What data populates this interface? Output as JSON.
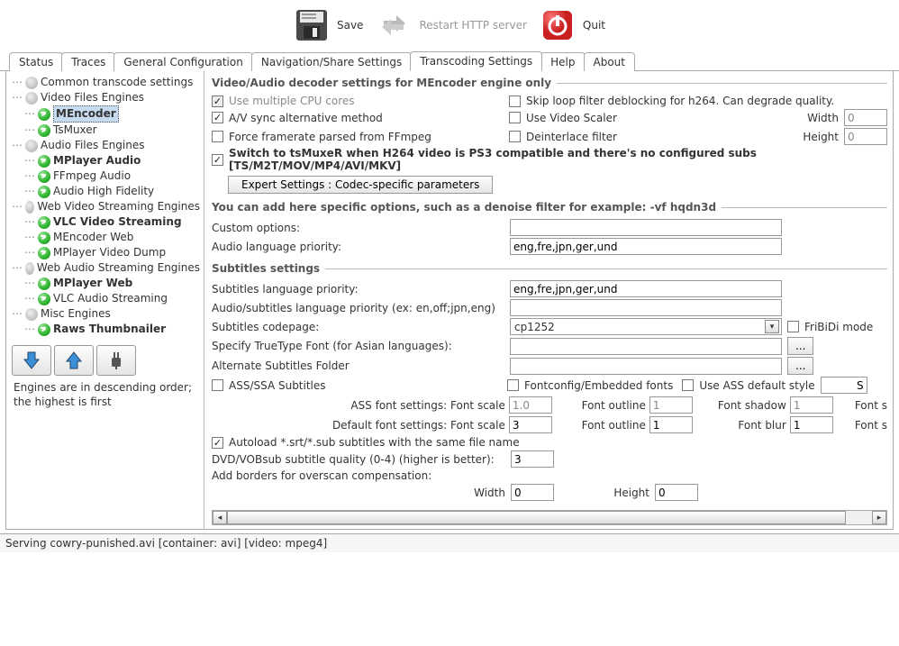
{
  "toolbar": {
    "save": "Save",
    "restart": "Restart HTTP server",
    "quit": "Quit"
  },
  "tabs": [
    "Status",
    "Traces",
    "General Configuration",
    "Navigation/Share Settings",
    "Transcoding Settings",
    "Help",
    "About"
  ],
  "sidebar": {
    "items": [
      {
        "label": "Common transcode settings",
        "level": 0,
        "icon": "gear",
        "bold": false
      },
      {
        "label": "Video Files Engines",
        "level": 0,
        "icon": "gear",
        "bold": false
      },
      {
        "label": "MEncoder",
        "level": 1,
        "icon": "green",
        "bold": true,
        "selected": true
      },
      {
        "label": "TsMuxer",
        "level": 1,
        "icon": "green",
        "bold": false
      },
      {
        "label": "Audio Files Engines",
        "level": 0,
        "icon": "gear",
        "bold": false
      },
      {
        "label": "MPlayer Audio",
        "level": 1,
        "icon": "green",
        "bold": true
      },
      {
        "label": "FFmpeg Audio",
        "level": 1,
        "icon": "green",
        "bold": false
      },
      {
        "label": "Audio High Fidelity",
        "level": 1,
        "icon": "green",
        "bold": false
      },
      {
        "label": "Web Video Streaming Engines",
        "level": 0,
        "icon": "gear",
        "bold": false
      },
      {
        "label": "VLC Video Streaming",
        "level": 1,
        "icon": "green",
        "bold": true
      },
      {
        "label": "MEncoder Web",
        "level": 1,
        "icon": "green",
        "bold": false
      },
      {
        "label": "MPlayer Video Dump",
        "level": 1,
        "icon": "green",
        "bold": false
      },
      {
        "label": "Web Audio Streaming Engines",
        "level": 0,
        "icon": "gear",
        "bold": false
      },
      {
        "label": "MPlayer Web",
        "level": 1,
        "icon": "green",
        "bold": true
      },
      {
        "label": "VLC Audio Streaming",
        "level": 1,
        "icon": "green",
        "bold": false
      },
      {
        "label": "Misc Engines",
        "level": 0,
        "icon": "gear",
        "bold": false
      },
      {
        "label": "Raws Thumbnailer",
        "level": 1,
        "icon": "green",
        "bold": true
      }
    ],
    "note": "Engines are in descending order; the highest is first"
  },
  "decoder": {
    "legend": "Video/Audio decoder settings for MEncoder engine only",
    "multi_cpu": "Use multiple CPU cores",
    "skip_loop": "Skip loop filter deblocking for h264. Can degrade quality.",
    "av_sync": "A/V sync alternative method",
    "use_scaler": "Use Video Scaler",
    "width_lbl": "Width",
    "width_val": "0",
    "force_fr": "Force framerate parsed from FFmpeg",
    "deint": "Deinterlace filter",
    "height_lbl": "Height",
    "height_val": "0",
    "switch_tsmuxer": "Switch to tsMuxeR when H264 video is PS3 compatible and there's no configured subs [TS/M2T/MOV/MP4/AVI/MKV]",
    "expert_btn": "Expert Settings : Codec-specific parameters"
  },
  "custom": {
    "legend": "You can add here specific options, such as a denoise filter for example: -vf hqdn3d",
    "custom_lbl": "Custom options:",
    "custom_val": "",
    "audio_lang_lbl": "Audio language priority:",
    "audio_lang_val": "eng,fre,jpn,ger,und"
  },
  "subs": {
    "legend": "Subtitles settings",
    "sub_lang_lbl": "Subtitles language priority:",
    "sub_lang_val": "eng,fre,jpn,ger,und",
    "as_lang_lbl": "Audio/subtitles language priority (ex: en,off;jpn,eng)",
    "as_lang_val": "",
    "codepage_lbl": "Subtitles codepage:",
    "codepage_val": "cp1252",
    "fribidi": "FriBiDi mode",
    "ttf_lbl": "Specify TrueType Font (for Asian languages):",
    "ttf_val": "",
    "altfolder_lbl": "Alternate Subtitles Folder",
    "altfolder_val": "",
    "browse": "...",
    "ass_ssa": "ASS/SSA Subtitles",
    "fontconfig": "Fontconfig/Embedded fonts",
    "use_ass_default": "Use ASS default style",
    "ass_default_val": "S",
    "ass_row_lbl": "ASS font settings: Font scale",
    "ass_scale": "1.0",
    "def_row_lbl": "Default font settings: Font scale",
    "def_scale": "3",
    "outline_lbl": "Font outline",
    "ass_outline": "1",
    "def_outline": "1",
    "shadow_lbl": "Font shadow",
    "ass_shadow": "1",
    "blur_lbl": "Font blur",
    "def_blur": "1",
    "font_s": "Font s",
    "autoload": "Autoload *.srt/*.sub subtitles with the same file name",
    "dvq_lbl": "DVD/VOBsub subtitle quality (0-4) (higher is better):",
    "dvq_val": "3",
    "overscan_lbl": "Add borders for overscan compensation:",
    "ov_width_lbl": "Width",
    "ov_width_val": "0",
    "ov_height_lbl": "Height",
    "ov_height_val": "0"
  },
  "status": "Serving cowry-punished.avi [container: avi] [video: mpeg4]"
}
